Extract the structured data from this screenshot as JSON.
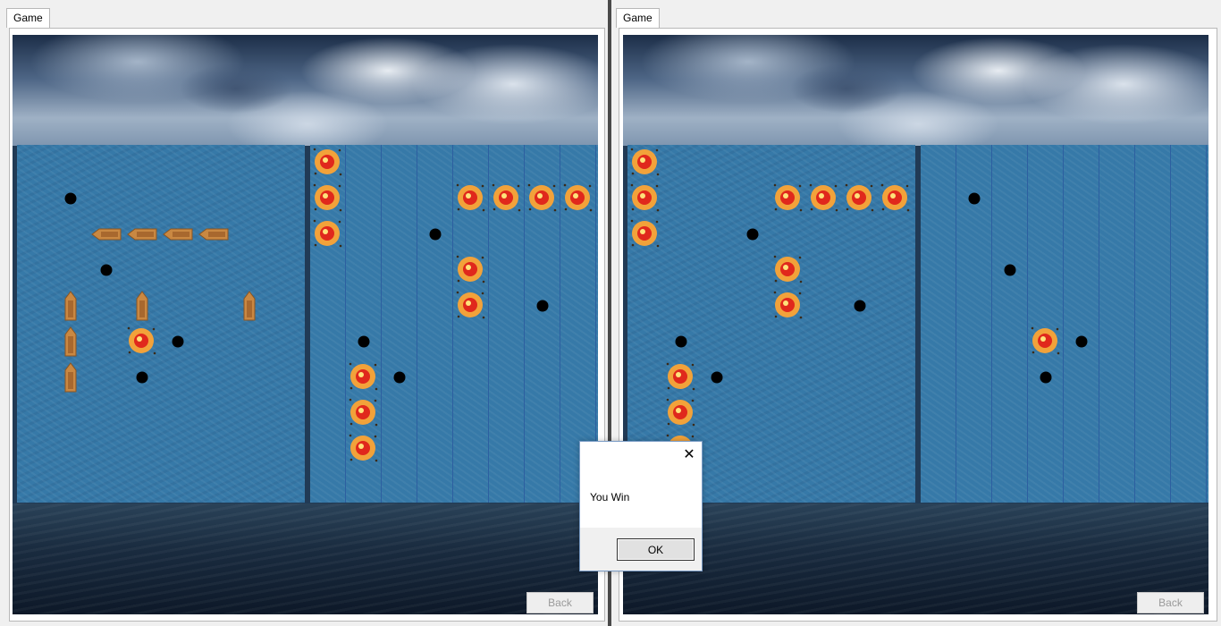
{
  "windows": [
    {
      "tab_label": "Game",
      "back_label": "Back",
      "boards": [
        {
          "grid_lines": false,
          "ships": [
            {
              "cell": [
                2,
                2
              ],
              "orient": "h"
            },
            {
              "cell": [
                3,
                2
              ],
              "orient": "h"
            },
            {
              "cell": [
                4,
                2
              ],
              "orient": "h"
            },
            {
              "cell": [
                5,
                2
              ],
              "orient": "h"
            },
            {
              "cell": [
                1,
                4
              ],
              "orient": "v"
            },
            {
              "cell": [
                1,
                5
              ],
              "orient": "v"
            },
            {
              "cell": [
                1,
                6
              ],
              "orient": "v"
            },
            {
              "cell": [
                3,
                4
              ],
              "orient": "v"
            },
            {
              "cell": [
                6,
                4
              ],
              "orient": "v"
            }
          ],
          "hits": [
            [
              3,
              5
            ]
          ],
          "misses": [
            [
              1,
              1
            ],
            [
              2,
              3
            ],
            [
              4,
              5
            ],
            [
              3,
              6
            ]
          ]
        },
        {
          "grid_lines": true,
          "ships": [],
          "hits": [
            [
              0,
              0
            ],
            [
              0,
              1
            ],
            [
              0,
              2
            ],
            [
              4,
              1
            ],
            [
              5,
              1
            ],
            [
              6,
              1
            ],
            [
              7,
              1
            ],
            [
              4,
              3
            ],
            [
              4,
              4
            ],
            [
              1,
              6
            ],
            [
              1,
              7
            ],
            [
              1,
              8
            ]
          ],
          "misses": [
            [
              3,
              2
            ],
            [
              6,
              4
            ],
            [
              1,
              5
            ],
            [
              2,
              6
            ]
          ]
        }
      ]
    },
    {
      "tab_label": "Game",
      "back_label": "Back",
      "boards": [
        {
          "grid_lines": false,
          "ships": [],
          "hits": [
            [
              0,
              0
            ],
            [
              0,
              1
            ],
            [
              0,
              2
            ],
            [
              4,
              1
            ],
            [
              5,
              1
            ],
            [
              6,
              1
            ],
            [
              7,
              1
            ],
            [
              4,
              3
            ],
            [
              4,
              4
            ],
            [
              1,
              6
            ],
            [
              1,
              7
            ],
            [
              1,
              8
            ]
          ],
          "misses": [
            [
              3,
              2
            ],
            [
              6,
              4
            ],
            [
              1,
              5
            ],
            [
              2,
              6
            ]
          ]
        },
        {
          "grid_lines": true,
          "ships": [],
          "hits": [
            [
              3,
              5
            ]
          ],
          "misses": [
            [
              1,
              1
            ],
            [
              2,
              3
            ],
            [
              4,
              5
            ],
            [
              3,
              6
            ]
          ]
        }
      ]
    }
  ],
  "dialog": {
    "message": "You Win",
    "ok_label": "OK",
    "close_glyph": "✕"
  },
  "colors": {
    "water": "#3679a8",
    "grid_line": "#2d5fa0",
    "ship": "#c98842",
    "fire_outer": "#f2a23a",
    "fire_core": "#e0281c"
  }
}
